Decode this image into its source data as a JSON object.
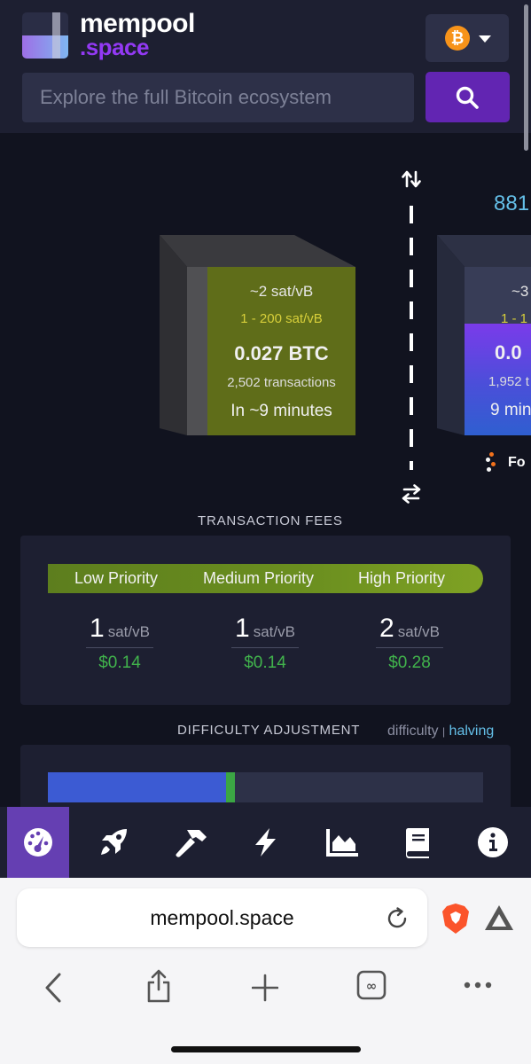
{
  "header": {
    "logo_line1": "mempool",
    "logo_line2": ".space",
    "network_symbol": "₿",
    "search_placeholder": "Explore the full Bitcoin ecosystem"
  },
  "blocks": {
    "next_block_height_partial": "881",
    "mempool_block": {
      "median_fee": "~2 sat/vB",
      "fee_range": "1 - 200 sat/vB",
      "total_fees": "0.027 BTC",
      "tx_count": "2,502 transactions",
      "eta": "In ~9 minutes"
    },
    "mined_block": {
      "median_fee": "~3",
      "fee_range": "1 - 1",
      "total_fees": "0.0",
      "tx_count": "1,952 t",
      "time": "9 min",
      "pool": "Fo"
    }
  },
  "fees": {
    "section_title": "TRANSACTION FEES",
    "labels": [
      "Low Priority",
      "Medium Priority",
      "High Priority"
    ],
    "values": [
      {
        "rate": "1",
        "unit": "sat/vB",
        "usd": "$0.14"
      },
      {
        "rate": "1",
        "unit": "sat/vB",
        "usd": "$0.14"
      },
      {
        "rate": "2",
        "unit": "sat/vB",
        "usd": "$0.28"
      }
    ]
  },
  "difficulty": {
    "section_title": "DIFFICULTY ADJUSTMENT",
    "link_difficulty": "difficulty",
    "separator": "|",
    "link_halving": "halving",
    "progress_fraction": 0.41
  },
  "nav": {
    "icons": [
      "dashboard-icon",
      "rocket-icon",
      "hammer-icon",
      "lightning-icon",
      "graphs-icon",
      "docs-icon",
      "info-icon"
    ],
    "active_index": 0
  },
  "browser": {
    "url": "mempool.space"
  },
  "colors": {
    "accent": "#653fb2",
    "block_green": "#5f6d19",
    "fee_green": "#41b34c",
    "link_blue": "#64bfe8"
  }
}
